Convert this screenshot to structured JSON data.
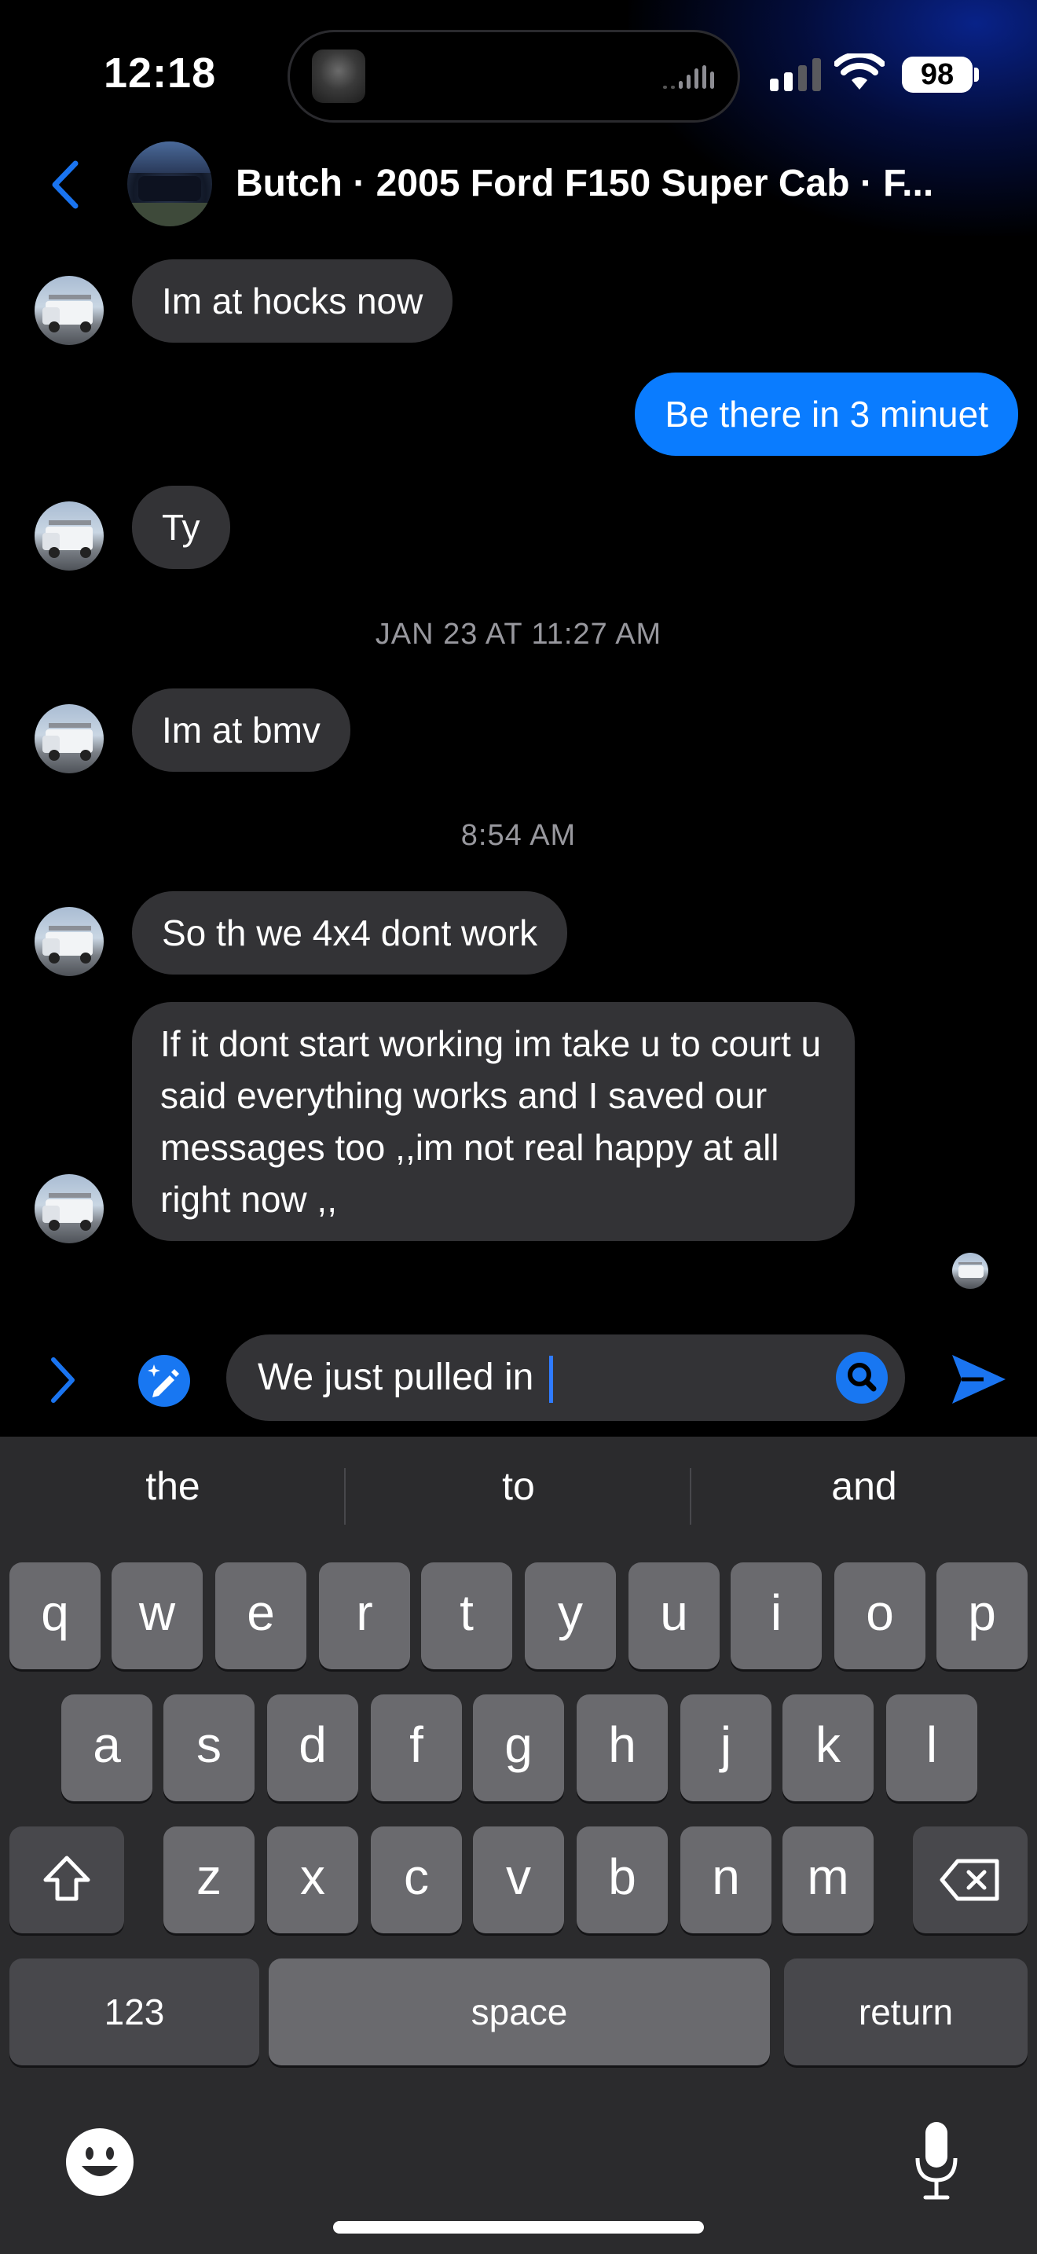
{
  "status_bar": {
    "time": "12:18",
    "battery": "98"
  },
  "header": {
    "title": "Butch · 2005 Ford F150 Super Cab · F..."
  },
  "messages": [
    {
      "sender": "them",
      "text": "Im at hocks now"
    },
    {
      "sender": "me",
      "text": "Be there in 3 minuet"
    },
    {
      "sender": "them",
      "text": "Ty"
    },
    {
      "sender": "them",
      "text": "Im at bmv"
    },
    {
      "sender": "them",
      "text": "So th we 4x4 dont work"
    },
    {
      "sender": "them",
      "text": "If it dont start working im take u to court u said everything works and I saved our messages too ,,im not real happy at all right now ,,"
    }
  ],
  "timestamps": [
    "JAN 23 AT 11:27 AM",
    "8:54 AM"
  ],
  "composer": {
    "text": "We just pulled in "
  },
  "keyboard": {
    "suggestions": [
      "the",
      "to",
      "and"
    ],
    "row1": [
      "q",
      "w",
      "e",
      "r",
      "t",
      "y",
      "u",
      "i",
      "o",
      "p"
    ],
    "row2": [
      "a",
      "s",
      "d",
      "f",
      "g",
      "h",
      "j",
      "k",
      "l"
    ],
    "row3": [
      "z",
      "x",
      "c",
      "v",
      "b",
      "n",
      "m"
    ],
    "numbers_key": "123",
    "space_key": "space",
    "return_key": "return"
  },
  "colors": {
    "accent": "#0a7cff",
    "incoming_bubble": "#333336",
    "keyboard_bg": "#2b2b2d",
    "key": "#6a6a6e"
  },
  "icons": {
    "back": "chevron-left-icon",
    "expand": "chevron-right-icon",
    "pen": "magic-pen-icon",
    "search": "search-icon",
    "send": "send-icon",
    "shift": "shift-icon",
    "delete": "delete-icon",
    "emoji": "emoji-icon",
    "mic": "microphone-icon"
  }
}
